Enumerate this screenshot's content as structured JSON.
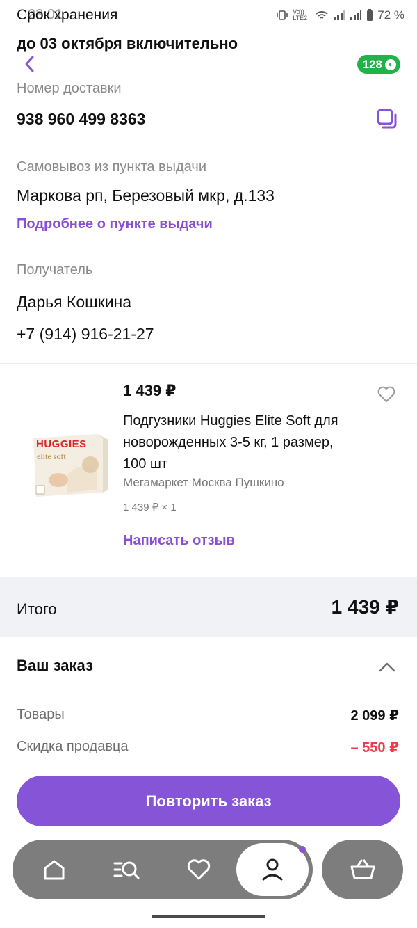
{
  "status_bar": {
    "time": "23:01",
    "network": "Vo)) LTE2",
    "battery": "72 %"
  },
  "storage": {
    "label": "Срок хранения",
    "value": "до 03 октября включительно"
  },
  "header": {
    "bonus_count": "128"
  },
  "delivery": {
    "label": "Номер доставки",
    "number": "938 960 499 8363"
  },
  "pickup": {
    "label": "Самовывоз из пункта выдачи",
    "address": "Маркова рп, Березовый мкр, д.133",
    "details_link": "Подробнее о пункте выдачи"
  },
  "recipient": {
    "label": "Получатель",
    "name": "Дарья Кошкина",
    "phone": "+7 (914) 916-21-27"
  },
  "product": {
    "price": "1 439 ₽",
    "title": "Подгузники Huggies Elite Soft для новорожденных 3-5 кг, 1 размер, 100 шт",
    "seller": "Мегамаркет Москва Пушкино",
    "quantity": "1 439 ₽ × 1",
    "review_link": "Написать отзыв",
    "image_brand": "HUGGIES",
    "image_line": "elite soft"
  },
  "total": {
    "label": "Итого",
    "value": "1 439 ₽"
  },
  "order_summary": {
    "title": "Ваш заказ",
    "rows": [
      {
        "label": "Товары",
        "value": "2 099 ₽"
      },
      {
        "label": "Скидка продавца",
        "value": "– 550 ₽"
      }
    ]
  },
  "actions": {
    "repeat_order": "Повторить заказ"
  },
  "nav": {
    "items": [
      "home-icon",
      "catalog-search-icon",
      "favorites-icon",
      "profile-icon",
      "cart-icon"
    ]
  },
  "colors": {
    "accent": "#8654d6",
    "bonus": "#21b24a",
    "discount": "#ef3b4a",
    "total_band": "#f1f2f6"
  }
}
